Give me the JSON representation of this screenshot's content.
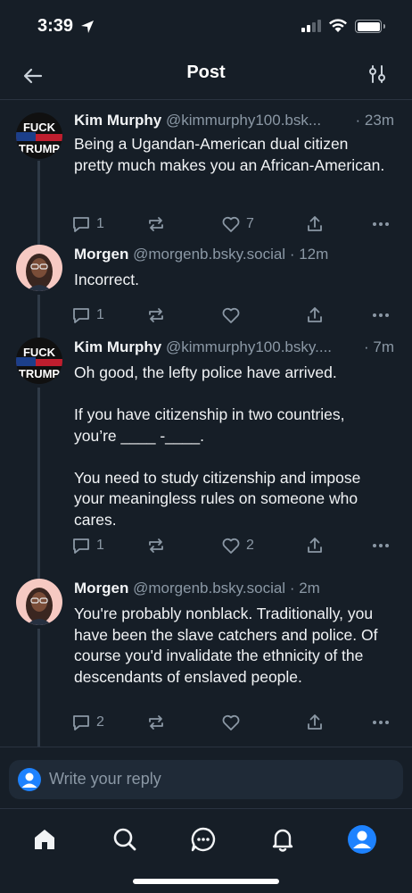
{
  "status_bar": {
    "time": "3:39"
  },
  "header": {
    "title": "Post"
  },
  "posts": [
    {
      "author": "Kim Murphy",
      "handle": "@kimmurphy100.bsk...",
      "time": "· 23m",
      "text": "Being a Ugandan-American dual citizen pretty much makes you an African-American.",
      "reply_count": "1",
      "repost_count": "",
      "like_count": "7",
      "avatar_text": [
        "FUCK",
        "TRUMP"
      ]
    },
    {
      "author": "Morgen",
      "handle": "@morgenb.bsky.social",
      "time": "· 12m",
      "text": "Incorrect.",
      "reply_count": "1",
      "repost_count": "",
      "like_count": ""
    },
    {
      "author": "Kim Murphy",
      "handle": "@kimmurphy100.bsky....",
      "time": "· 7m",
      "text": "Oh good, the lefty police have arrived.\n\nIf you have citizenship in two countries, you’re ____ -____.\n\nYou need to study citizenship and impose your meaningless rules on someone who cares.",
      "reply_count": "1",
      "repost_count": "",
      "like_count": "2",
      "avatar_text": [
        "FUCK",
        "TRUMP"
      ]
    },
    {
      "author": "Morgen",
      "handle": "@morgenb.bsky.social",
      "time": "· 2m",
      "text": "You're probably nonblack. Traditionally, you have been the slave catchers and police. Of course you'd invalidate the ethnicity of the descendants of enslaved people.",
      "reply_count": "2",
      "repost_count": "",
      "like_count": ""
    }
  ],
  "reply_bar": {
    "placeholder": "Write your reply"
  },
  "nav": {
    "items": [
      "home-icon",
      "search-icon",
      "chat-icon",
      "bell-icon",
      "profile-icon"
    ]
  },
  "colors": {
    "accent": "#1d82ff",
    "background": "#161e27",
    "muted": "#8b98a5"
  }
}
